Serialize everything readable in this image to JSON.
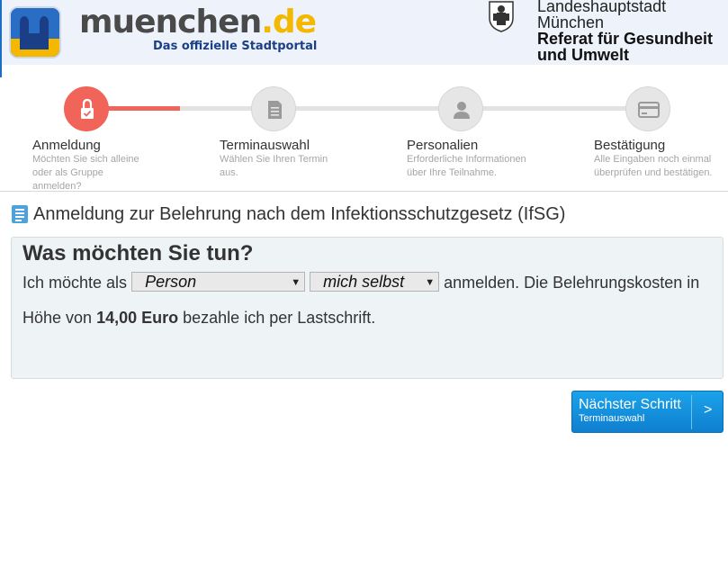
{
  "header": {
    "brand_name": "muenchen",
    "brand_tld": ".de",
    "brand_tagline": "Das offizielle Stadtportal",
    "city_line_1": "Landeshauptstadt",
    "city_line_2": "München",
    "dept_line_1": "Referat für Gesundheit",
    "dept_line_2": "und Umwelt"
  },
  "stepper": {
    "active_color": "#f0645a",
    "steps": [
      {
        "title": "Anmeldung",
        "desc_1": "Möchten Sie sich alleine",
        "desc_2": "oder als Gruppe",
        "desc_3": "anmelden?",
        "icon": "lock-check-icon",
        "active": true
      },
      {
        "title": "Terminauswahl",
        "desc_1": "Wählen Sie Ihren Termin",
        "desc_2": "aus.",
        "desc_3": "",
        "icon": "document-icon",
        "active": false
      },
      {
        "title": "Personalien",
        "desc_1": "Erforderliche Informationen",
        "desc_2": "über Ihre Teilnahme.",
        "desc_3": "",
        "icon": "person-icon",
        "active": false
      },
      {
        "title": "Bestätigung",
        "desc_1": "Alle Eingaben noch einmal",
        "desc_2": "überprüfen und bestätigen.",
        "desc_3": "",
        "icon": "credit-card-icon",
        "active": false
      }
    ]
  },
  "page": {
    "title": "Anmeldung zur Belehrung nach dem Infektionsschutzgesetz (IfSG)"
  },
  "panel": {
    "heading": "Was möchten Sie tun?",
    "prefix": "Ich möchte als",
    "select_type": {
      "value": "Person"
    },
    "select_who": {
      "value": "mich selbst"
    },
    "suffix": "anmelden. Die Belehrungskosten in",
    "cost_prefix": "Höhe von",
    "cost_amount": "14,00 Euro",
    "cost_suffix": "bezahle ich per Lastschrift."
  },
  "next_button": {
    "label": "Nächster Schritt",
    "sublabel": "Terminauswahl",
    "arrow": ">"
  }
}
